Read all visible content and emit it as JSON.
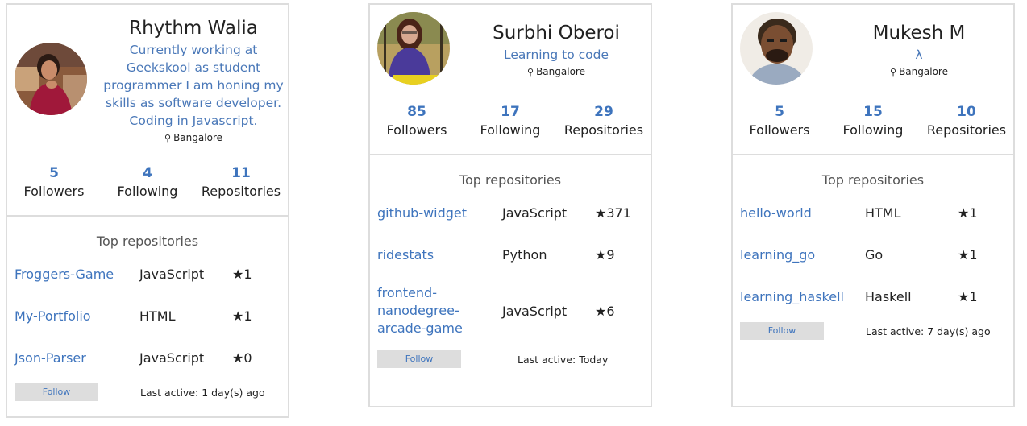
{
  "colors": {
    "accent": "#3e74bd",
    "border": "#dddddd",
    "button_bg": "#dddddd",
    "text": "#222222"
  },
  "section_title": "Top repositories",
  "follow_label": "Follow",
  "location_icon": "map-pin-icon",
  "star_icon": "star-icon",
  "users": [
    {
      "name": "Rhythm Walia",
      "bio": "Currently working at Geekskool as student programmer I am honing my skills as software developer. Coding in Javascript.",
      "location": "Bangalore",
      "stats": [
        {
          "value": "5",
          "label": "Followers"
        },
        {
          "value": "4",
          "label": "Following"
        },
        {
          "value": "11",
          "label": "Repositories"
        }
      ],
      "repos": [
        {
          "name": "Froggers-Game",
          "language": "JavaScript",
          "stars": "★1"
        },
        {
          "name": "My-Portfolio",
          "language": "HTML",
          "stars": "★1"
        },
        {
          "name": "Json-Parser",
          "language": "JavaScript",
          "stars": "★0"
        }
      ],
      "last_active": "Last active: 1 day(s) ago"
    },
    {
      "name": "Surbhi Oberoi",
      "bio": "Learning to code",
      "location": "Bangalore",
      "stats": [
        {
          "value": "85",
          "label": "Followers"
        },
        {
          "value": "17",
          "label": "Following"
        },
        {
          "value": "29",
          "label": "Repositories"
        }
      ],
      "repos": [
        {
          "name": "github-widget",
          "language": "JavaScript",
          "stars": "★371"
        },
        {
          "name": "ridestats",
          "language": "Python",
          "stars": "★9"
        },
        {
          "name": "frontend-nanodegree-arcade-game",
          "language": "JavaScript",
          "stars": "★6"
        }
      ],
      "last_active": "Last active: Today"
    },
    {
      "name": "Mukesh M",
      "bio": "λ",
      "location": "Bangalore",
      "stats": [
        {
          "value": "5",
          "label": "Followers"
        },
        {
          "value": "15",
          "label": "Following"
        },
        {
          "value": "10",
          "label": "Repositories"
        }
      ],
      "repos": [
        {
          "name": "hello-world",
          "language": "HTML",
          "stars": "★1"
        },
        {
          "name": "learning_go",
          "language": "Go",
          "stars": "★1"
        },
        {
          "name": "learning_haskell",
          "language": "Haskell",
          "stars": "★1"
        }
      ],
      "last_active": "Last active: 7 day(s) ago"
    }
  ]
}
